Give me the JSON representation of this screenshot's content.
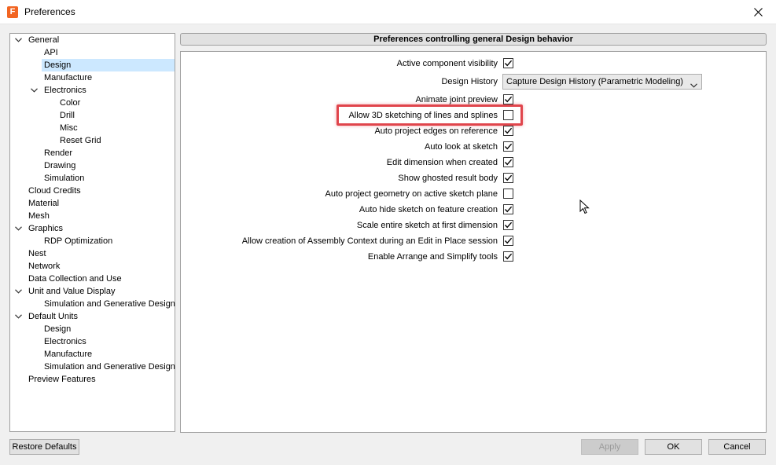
{
  "window": {
    "title": "Preferences",
    "app_icon_letter": "F"
  },
  "tree": {
    "items": [
      {
        "label": "General",
        "level": 0,
        "expanded": true
      },
      {
        "label": "API",
        "level": 1
      },
      {
        "label": "Design",
        "level": 1,
        "selected": true
      },
      {
        "label": "Manufacture",
        "level": 1
      },
      {
        "label": "Electronics",
        "level": 1,
        "expanded": true
      },
      {
        "label": "Color",
        "level": 2
      },
      {
        "label": "Drill",
        "level": 2
      },
      {
        "label": "Misc",
        "level": 2
      },
      {
        "label": "Reset Grid",
        "level": 2
      },
      {
        "label": "Render",
        "level": 1
      },
      {
        "label": "Drawing",
        "level": 1
      },
      {
        "label": "Simulation",
        "level": 1
      },
      {
        "label": "Cloud Credits",
        "level": 0
      },
      {
        "label": "Material",
        "level": 0
      },
      {
        "label": "Mesh",
        "level": 0
      },
      {
        "label": "Graphics",
        "level": 0,
        "expanded": true
      },
      {
        "label": "RDP Optimization",
        "level": 1
      },
      {
        "label": "Nest",
        "level": 0
      },
      {
        "label": "Network",
        "level": 0
      },
      {
        "label": "Data Collection and Use",
        "level": 0
      },
      {
        "label": "Unit and Value Display",
        "level": 0,
        "expanded": true
      },
      {
        "label": "Simulation and Generative Design",
        "level": 1
      },
      {
        "label": "Default Units",
        "level": 0,
        "expanded": true
      },
      {
        "label": "Design",
        "level": 1
      },
      {
        "label": "Electronics",
        "level": 1
      },
      {
        "label": "Manufacture",
        "level": 1
      },
      {
        "label": "Simulation and Generative Design",
        "level": 1
      },
      {
        "label": "Preview Features",
        "level": 0
      }
    ]
  },
  "panel": {
    "header": "Preferences controlling general Design behavior",
    "options": [
      {
        "label": "Active component visibility",
        "checked": true
      },
      {
        "label": "Design History",
        "type": "select",
        "value": "Capture Design History (Parametric Modeling)"
      },
      {
        "label": "Animate joint preview",
        "checked": true
      },
      {
        "label": "Allow 3D sketching of lines and splines",
        "checked": false,
        "highlighted": true
      },
      {
        "label": "Auto project edges on reference",
        "checked": true
      },
      {
        "label": "Auto look at sketch",
        "checked": true
      },
      {
        "label": "Edit dimension when created",
        "checked": true
      },
      {
        "label": "Show ghosted result body",
        "checked": true
      },
      {
        "label": "Auto project geometry on active sketch plane",
        "checked": false
      },
      {
        "label": "Auto hide sketch on feature creation",
        "checked": true
      },
      {
        "label": "Scale entire sketch at first dimension",
        "checked": true
      },
      {
        "label": "Allow creation of Assembly Context during an Edit in Place session",
        "checked": true
      },
      {
        "label": "Enable Arrange and Simplify tools",
        "checked": true
      }
    ]
  },
  "buttons": {
    "restore_defaults": "Restore Defaults",
    "apply": "Apply",
    "ok": "OK",
    "cancel": "Cancel"
  },
  "colors": {
    "selection": "#cce8ff",
    "highlight_box": "#e0454c",
    "app_icon": "#f26522"
  },
  "icons": {
    "close": "close-icon",
    "expand": "chevron-down-icon",
    "check": "check-icon",
    "cursor": "mouse-pointer-icon"
  }
}
